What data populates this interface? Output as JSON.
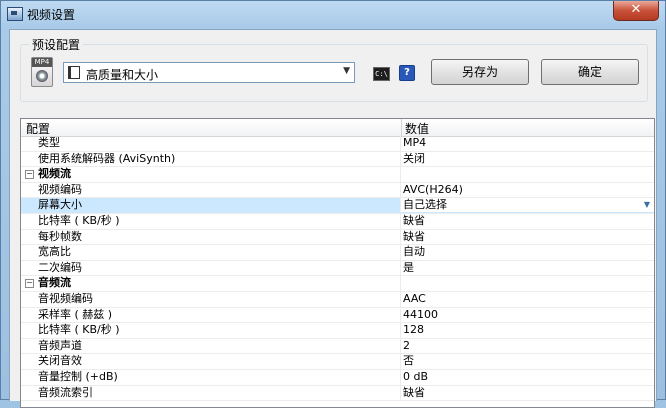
{
  "window": {
    "title": "视频设置",
    "close_glyph": "✕"
  },
  "preset": {
    "group_label": "预设配置",
    "format_icon": "mp4-file-icon",
    "format_icon_text": "MP4",
    "selected": "高质量和大小",
    "cmd_icon": "command-line-icon",
    "cmd_icon_text": "C:\\",
    "help_icon": "?",
    "save_as_label": "另存为",
    "ok_label": "确定"
  },
  "grid": {
    "columns": [
      "配置",
      "数值"
    ],
    "rows": [
      {
        "kind": "item",
        "name": "类型",
        "value": "MP4"
      },
      {
        "kind": "item",
        "name": "使用系统解码器 (AviSynth)",
        "value": "关闭"
      },
      {
        "kind": "category",
        "toggle": "⊟",
        "name": "视频流",
        "value": ""
      },
      {
        "kind": "sub",
        "name": "视频编码",
        "value": "AVC(H264)"
      },
      {
        "kind": "sub-selected",
        "name": "屏幕大小",
        "value": "自己选择"
      },
      {
        "kind": "sub",
        "name": "比特率 ( KB/秒 )",
        "value": "缺省"
      },
      {
        "kind": "sub",
        "name": "每秒帧数",
        "value": "缺省"
      },
      {
        "kind": "sub",
        "name": "宽高比",
        "value": "自动"
      },
      {
        "kind": "sub",
        "name": "二次编码",
        "value": "是"
      },
      {
        "kind": "category",
        "toggle": "⊟",
        "name": "音频流",
        "value": ""
      },
      {
        "kind": "sub",
        "name": "音视频编码",
        "value": "AAC"
      },
      {
        "kind": "sub",
        "name": "采样率 ( 赫兹 )",
        "value": "44100"
      },
      {
        "kind": "sub",
        "name": "比特率 ( KB/秒 )",
        "value": "128"
      },
      {
        "kind": "sub",
        "name": "音频声道",
        "value": "2"
      },
      {
        "kind": "sub",
        "name": "关闭音效",
        "value": "否"
      },
      {
        "kind": "sub",
        "name": "音量控制 (+dB)",
        "value": "0 dB"
      },
      {
        "kind": "sub",
        "name": "音频流索引",
        "value": "缺省"
      }
    ]
  }
}
